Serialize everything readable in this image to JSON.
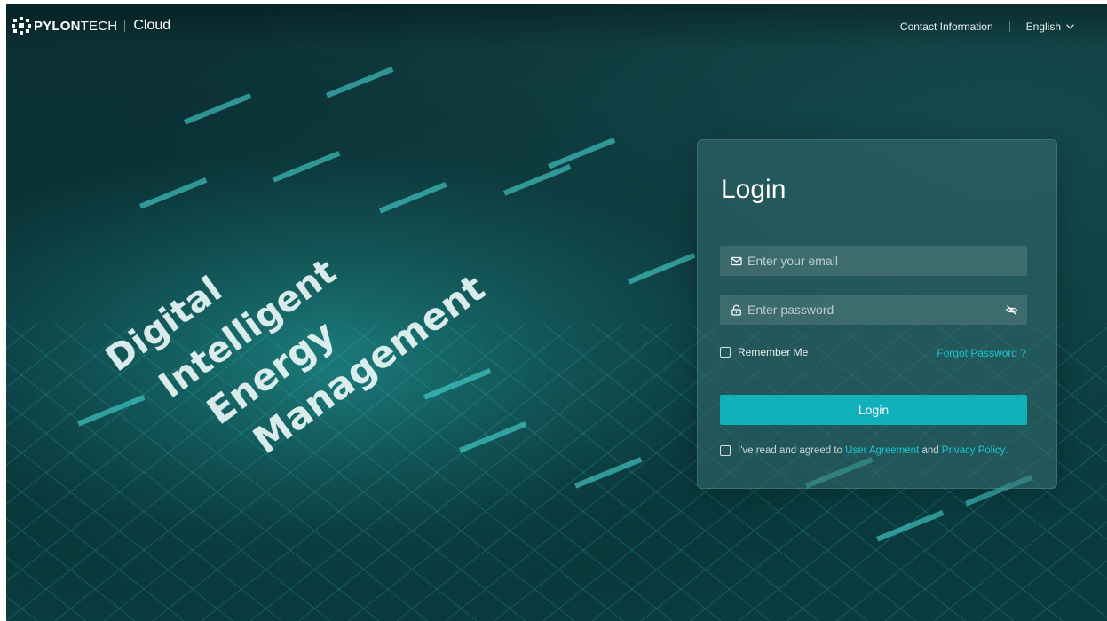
{
  "header": {
    "brand_bold": "PYLON",
    "brand_light": "TECH",
    "product": "Cloud",
    "contact_label": "Contact Information",
    "language": "English"
  },
  "hero": {
    "words": [
      "Digital",
      "Intelligent",
      "Energy",
      "Management"
    ]
  },
  "login": {
    "title": "Login",
    "email_placeholder": "Enter your email",
    "password_placeholder": "Enter password",
    "remember_label": "Remember Me",
    "forgot_label": "Forgot Password ?",
    "button_label": "Login",
    "agree_prefix": "I've read and agreed to",
    "user_agreement": "User Agreement",
    "and_text": "and",
    "privacy_policy": "Privacy Policy",
    "period": "."
  },
  "colors": {
    "accent": "#11b1bb",
    "link": "#1cc5d2",
    "background": "#0a3438"
  },
  "icons": {
    "email": "mail-icon",
    "password": "lock-icon",
    "visibility": "eye-off-icon",
    "language_dropdown": "chevron-down-icon"
  }
}
